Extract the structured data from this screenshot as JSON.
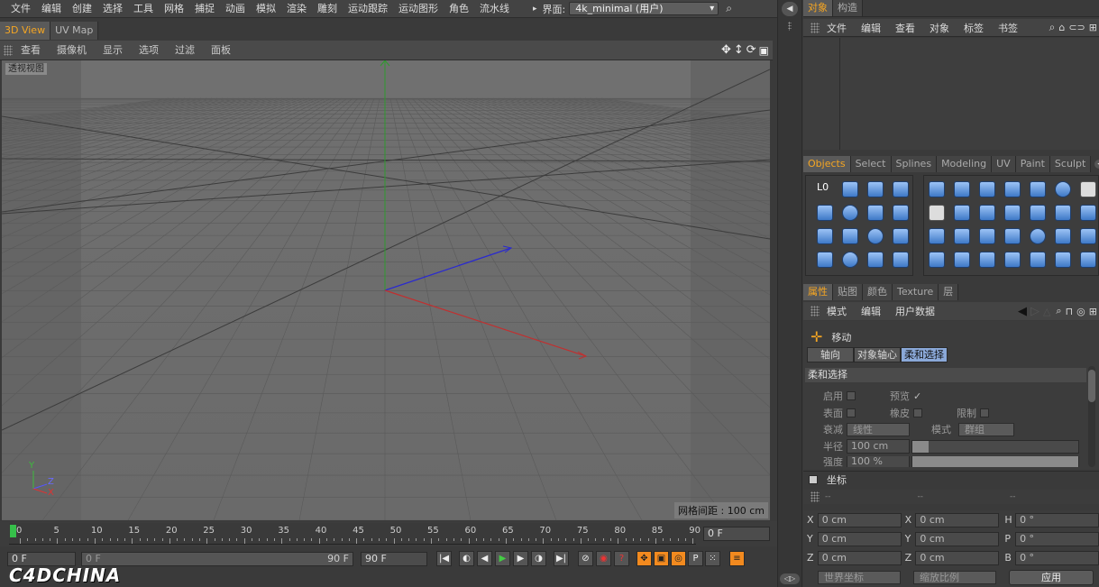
{
  "menubar": {
    "items": [
      "文件",
      "编辑",
      "创建",
      "选择",
      "工具",
      "网格",
      "捕捉",
      "动画",
      "模拟",
      "渲染",
      "雕刻",
      "运动跟踪",
      "运动图形",
      "角色",
      "流水线"
    ],
    "layout_label": "界面:",
    "layout_value": "4k_minimal (用户)"
  },
  "view_tabs": [
    {
      "label": "3D View",
      "active": true
    },
    {
      "label": "UV Map",
      "active": false
    }
  ],
  "viewport_menu": [
    "查看",
    "摄像机",
    "显示",
    "选项",
    "过滤",
    "面板"
  ],
  "viewport": {
    "label": "透视视图",
    "grid_spacing": "网格间距 : 100 cm",
    "axis_y": "Y",
    "axis_z": "Z",
    "axis_x": "X"
  },
  "timeline": {
    "ticks": [
      "0",
      "5",
      "10",
      "15",
      "20",
      "25",
      "30",
      "35",
      "40",
      "45",
      "50",
      "55",
      "60",
      "65",
      "70",
      "75",
      "80",
      "85",
      "90"
    ],
    "current_frame": "0 F"
  },
  "controls": {
    "start": "0 F",
    "range_start": "0 F",
    "range_end": "90 F",
    "end": "90 F"
  },
  "brand": "C4DCHINA",
  "object_panel": {
    "tabs": [
      {
        "label": "对象",
        "active": true
      },
      {
        "label": "构造",
        "active": false
      }
    ],
    "menu": [
      "文件",
      "编辑",
      "查看",
      "对象",
      "标签",
      "书签"
    ]
  },
  "palette": {
    "tabs": [
      {
        "label": "Objects",
        "active": true
      },
      {
        "label": "Select"
      },
      {
        "label": "Splines"
      },
      {
        "label": "Modeling"
      },
      {
        "label": "UV"
      },
      {
        "label": "Paint"
      },
      {
        "label": "Sculpt"
      }
    ]
  },
  "attributes": {
    "tabs": [
      {
        "label": "属性",
        "active": true
      },
      {
        "label": "贴图"
      },
      {
        "label": "颜色"
      },
      {
        "label": "Texture"
      },
      {
        "label": "层"
      }
    ],
    "menu": [
      "模式",
      "编辑",
      "用户数据"
    ],
    "tool": "移动",
    "subtabs": [
      {
        "label": "轴向"
      },
      {
        "label": "对象轴心"
      },
      {
        "label": "柔和选择",
        "active": true
      }
    ],
    "section": "柔和选择",
    "enable": "启用",
    "preview": "预览",
    "surface": "表面",
    "rubber": "橡皮",
    "restrict": "限制",
    "falloff": "衰减",
    "falloff_value": "线性",
    "mode": "模式",
    "mode_value": "群组",
    "radius": "半径",
    "radius_value": "100 cm",
    "strength": "强度",
    "strength_value": "100 %"
  },
  "coords": {
    "title": "坐标",
    "col_headers": [
      "--",
      "--",
      "--"
    ],
    "rows": [
      {
        "a": "X",
        "av": "0 cm",
        "b": "X",
        "bv": "0 cm",
        "c": "H",
        "cv": "0 °"
      },
      {
        "a": "Y",
        "av": "0 cm",
        "b": "Y",
        "bv": "0 cm",
        "c": "P",
        "cv": "0 °"
      },
      {
        "a": "Z",
        "av": "0 cm",
        "b": "Z",
        "bv": "0 cm",
        "c": "B",
        "cv": "0 °"
      }
    ],
    "world": "世界坐标",
    "scale": "缩放比例",
    "apply": "应用"
  }
}
